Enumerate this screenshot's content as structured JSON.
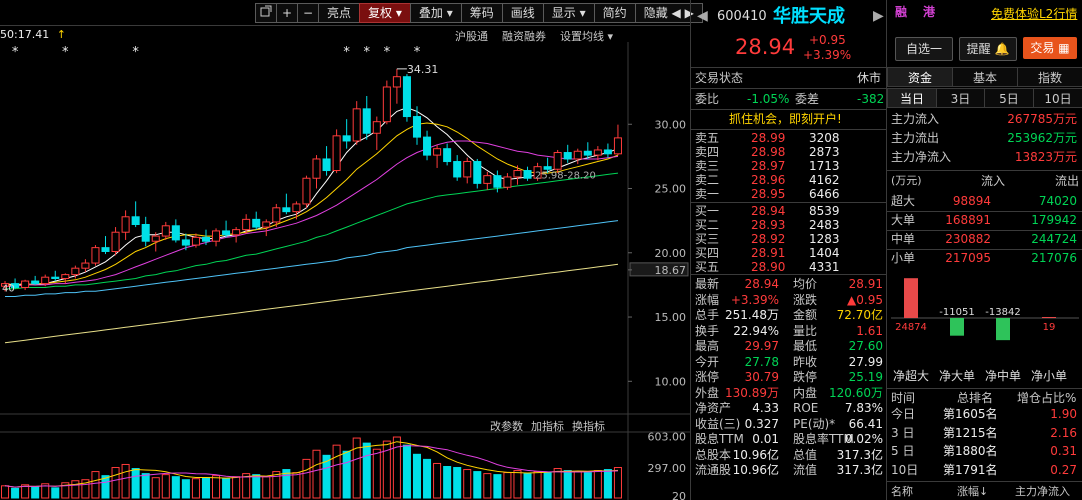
{
  "toolbar": {
    "items": [
      "亮点",
      "复权",
      "叠加",
      "筹码",
      "画线",
      "显示",
      "简约",
      "隐藏"
    ],
    "dropdown_marks": [
      "",
      "▾",
      "▾",
      "",
      "",
      "▾",
      "",
      ""
    ],
    "chevrons": "◀ ▶"
  },
  "chart_sub": {
    "cursor_readout": "50:17.41",
    "links": [
      "沪股通",
      "融资融券",
      "设置均线"
    ],
    "high_label": "34.31",
    "mark_label": "40",
    "price_axis": [
      "30.00",
      "25.00",
      "20.00",
      "18.67",
      "15.00",
      "10.00"
    ],
    "ma_label": "25.98-28.20",
    "vol_links": [
      "改参数",
      "加指标",
      "换指标"
    ],
    "vol_axis": [
      "603.00",
      "297.00",
      "20"
    ]
  },
  "chart_data": {
    "type": "candlestick",
    "price_ylim": [
      8,
      35
    ],
    "candles": [
      [
        17.4,
        17.8,
        17.0,
        17.6
      ],
      [
        17.6,
        18.0,
        17.2,
        17.3
      ],
      [
        17.3,
        17.9,
        17.1,
        17.8
      ],
      [
        17.8,
        18.2,
        17.5,
        17.6
      ],
      [
        17.6,
        18.3,
        17.4,
        18.1
      ],
      [
        18.1,
        18.6,
        17.8,
        18.0
      ],
      [
        18.0,
        18.4,
        17.6,
        18.3
      ],
      [
        18.3,
        19.0,
        18.0,
        18.8
      ],
      [
        18.8,
        19.5,
        18.5,
        19.2
      ],
      [
        19.2,
        20.6,
        19.0,
        20.4
      ],
      [
        20.4,
        21.3,
        19.9,
        20.1
      ],
      [
        20.1,
        22.0,
        19.8,
        21.6
      ],
      [
        21.6,
        23.3,
        21.0,
        22.8
      ],
      [
        22.8,
        24.0,
        22.0,
        22.2
      ],
      [
        22.2,
        22.8,
        20.5,
        20.9
      ],
      [
        20.9,
        21.6,
        20.1,
        21.3
      ],
      [
        21.3,
        22.4,
        21.0,
        22.1
      ],
      [
        22.1,
        22.6,
        20.8,
        21.0
      ],
      [
        21.0,
        21.5,
        20.2,
        20.6
      ],
      [
        20.6,
        21.5,
        20.4,
        21.2
      ],
      [
        21.2,
        21.8,
        20.6,
        20.9
      ],
      [
        20.9,
        21.9,
        20.5,
        21.7
      ],
      [
        21.7,
        22.5,
        21.2,
        21.4
      ],
      [
        21.4,
        22.0,
        20.8,
        21.8
      ],
      [
        21.8,
        23.0,
        21.5,
        22.6
      ],
      [
        22.6,
        23.2,
        21.8,
        22.0
      ],
      [
        22.0,
        22.6,
        21.3,
        22.4
      ],
      [
        22.4,
        23.8,
        22.0,
        23.5
      ],
      [
        23.5,
        24.6,
        23.0,
        23.2
      ],
      [
        23.2,
        24.0,
        22.6,
        23.8
      ],
      [
        23.8,
        26.0,
        23.5,
        25.8
      ],
      [
        25.8,
        27.6,
        25.0,
        27.3
      ],
      [
        27.3,
        28.3,
        26.0,
        26.4
      ],
      [
        26.4,
        29.6,
        26.2,
        29.1
      ],
      [
        29.1,
        30.4,
        28.1,
        28.7
      ],
      [
        28.7,
        31.8,
        28.4,
        31.2
      ],
      [
        31.2,
        32.2,
        28.8,
        29.3
      ],
      [
        29.3,
        30.6,
        28.0,
        30.2
      ],
      [
        30.2,
        33.4,
        30.0,
        32.9
      ],
      [
        32.9,
        34.31,
        31.6,
        33.7
      ],
      [
        33.7,
        33.9,
        30.2,
        30.6
      ],
      [
        30.6,
        31.4,
        28.4,
        29.0
      ],
      [
        29.0,
        29.5,
        27.2,
        27.6
      ],
      [
        27.6,
        28.4,
        26.6,
        28.1
      ],
      [
        28.1,
        28.5,
        26.8,
        27.1
      ],
      [
        27.1,
        27.6,
        25.6,
        25.9
      ],
      [
        25.9,
        27.4,
        25.4,
        27.1
      ],
      [
        27.1,
        27.3,
        25.0,
        25.4
      ],
      [
        25.4,
        26.3,
        24.9,
        26.0
      ],
      [
        26.0,
        26.4,
        24.7,
        25.1
      ],
      [
        25.1,
        26.2,
        24.9,
        25.9
      ],
      [
        25.9,
        26.8,
        25.3,
        26.4
      ],
      [
        26.4,
        26.7,
        25.6,
        25.8
      ],
      [
        25.8,
        27.0,
        25.6,
        26.7
      ],
      [
        26.7,
        27.4,
        26.2,
        26.5
      ],
      [
        26.5,
        28.0,
        26.2,
        27.8
      ],
      [
        27.8,
        28.4,
        27.0,
        27.3
      ],
      [
        27.3,
        28.1,
        26.9,
        27.9
      ],
      [
        27.9,
        28.6,
        27.3,
        27.6
      ],
      [
        27.6,
        28.3,
        27.2,
        28.0
      ],
      [
        28.0,
        28.5,
        27.4,
        27.7
      ],
      [
        27.7,
        29.97,
        27.6,
        28.94
      ]
    ],
    "volume_ylim": [
      0,
      620
    ],
    "volumes": [
      120,
      95,
      130,
      110,
      140,
      100,
      150,
      170,
      180,
      260,
      220,
      300,
      330,
      290,
      240,
      200,
      230,
      210,
      180,
      190,
      200,
      220,
      190,
      210,
      240,
      230,
      210,
      260,
      280,
      250,
      380,
      470,
      420,
      520,
      460,
      590,
      540,
      480,
      560,
      600,
      520,
      430,
      380,
      340,
      310,
      300,
      280,
      260,
      240,
      230,
      250,
      270,
      240,
      260,
      250,
      290,
      270,
      260,
      250,
      270,
      280,
      300
    ],
    "ma_series": [
      {
        "color": "#ffffff",
        "values": [
          17.6,
          17.5,
          17.6,
          17.5,
          17.6,
          17.8,
          18.0,
          18.2,
          18.5,
          18.9,
          19.3,
          19.9,
          20.6,
          21.2,
          21.4,
          21.4,
          21.6,
          21.6,
          21.4,
          21.2,
          21.1,
          21.1,
          21.3,
          21.4,
          21.7,
          21.8,
          22.1,
          22.5,
          22.8,
          23.0,
          23.5,
          24.6,
          25.6,
          26.7,
          27.8,
          28.6,
          29.0,
          29.5,
          30.3,
          31.0,
          31.3,
          31.0,
          30.5,
          29.8,
          29.2,
          28.4,
          27.6,
          26.9,
          26.4,
          25.9,
          25.7,
          25.8,
          25.9,
          26.1,
          26.3,
          26.6,
          26.9,
          27.2,
          27.4,
          27.6,
          27.8,
          28.1
        ]
      },
      {
        "color": "#ffd400",
        "values": [
          17.5,
          17.5,
          17.5,
          17.6,
          17.6,
          17.7,
          17.8,
          17.9,
          18.1,
          18.4,
          18.7,
          19.1,
          19.6,
          20.1,
          20.4,
          20.8,
          21.1,
          21.3,
          21.4,
          21.4,
          21.3,
          21.3,
          21.4,
          21.5,
          21.6,
          21.8,
          21.9,
          22.2,
          22.5,
          22.8,
          23.2,
          23.7,
          24.3,
          25.0,
          25.7,
          26.5,
          27.1,
          27.7,
          28.4,
          29.1,
          29.6,
          30.0,
          30.1,
          30.0,
          29.8,
          29.4,
          28.9,
          28.3,
          27.8,
          27.3,
          26.9,
          26.6,
          26.3,
          26.2,
          26.2,
          26.3,
          26.5,
          26.7,
          26.9,
          27.1,
          27.3,
          27.6
        ]
      },
      {
        "color": "#e040e0",
        "values": [
          17.4,
          17.4,
          17.5,
          17.5,
          17.5,
          17.6,
          17.6,
          17.7,
          17.8,
          17.9,
          18.1,
          18.3,
          18.6,
          18.9,
          19.2,
          19.5,
          19.8,
          20.1,
          20.4,
          20.6,
          20.8,
          21.0,
          21.2,
          21.3,
          21.5,
          21.6,
          21.7,
          21.9,
          22.1,
          22.3,
          22.6,
          22.9,
          23.3,
          23.7,
          24.2,
          24.7,
          25.2,
          25.7,
          26.3,
          26.9,
          27.4,
          27.8,
          28.1,
          28.4,
          28.6,
          28.7,
          28.7,
          28.6,
          28.5,
          28.3,
          28.1,
          27.9,
          27.8,
          27.6,
          27.5,
          27.4,
          27.3,
          27.3,
          27.3,
          27.3,
          27.4,
          27.5
        ]
      },
      {
        "color": "#00d455",
        "values": [
          17.2,
          17.2,
          17.3,
          17.3,
          17.3,
          17.4,
          17.4,
          17.5,
          17.5,
          17.6,
          17.7,
          17.8,
          17.9,
          18.0,
          18.2,
          18.3,
          18.5,
          18.6,
          18.8,
          19.0,
          19.1,
          19.3,
          19.4,
          19.6,
          19.8,
          19.9,
          20.1,
          20.3,
          20.5,
          20.7,
          20.9,
          21.2,
          21.4,
          21.7,
          22.0,
          22.3,
          22.6,
          22.9,
          23.2,
          23.5,
          23.8,
          24.0,
          24.2,
          24.4,
          24.5,
          24.6,
          24.7,
          24.8,
          24.9,
          25.0,
          25.1,
          25.2,
          25.3,
          25.4,
          25.5,
          25.6,
          25.7,
          25.8,
          25.9,
          26.0,
          26.1,
          26.2
        ]
      },
      {
        "color": "#4fc3f7",
        "values": [
          16.6,
          16.6,
          16.7,
          16.7,
          16.8,
          16.8,
          16.9,
          16.9,
          17.0,
          17.0,
          17.1,
          17.2,
          17.3,
          17.4,
          17.5,
          17.6,
          17.7,
          17.8,
          17.9,
          18.0,
          18.1,
          18.2,
          18.3,
          18.4,
          18.5,
          18.6,
          18.7,
          18.8,
          18.9,
          19.0,
          19.1,
          19.2,
          19.3,
          19.4,
          19.6,
          19.7,
          19.8,
          20.0,
          20.1,
          20.2,
          20.4,
          20.5,
          20.6,
          20.7,
          20.8,
          20.9,
          21.0,
          21.1,
          21.2,
          21.3,
          21.4,
          21.5,
          21.6,
          21.7,
          21.8,
          21.9,
          22.0,
          22.1,
          22.2,
          22.3,
          22.4,
          22.5
        ]
      },
      {
        "color": "#e8e08a",
        "values": [
          13.0,
          13.1,
          13.2,
          13.3,
          13.4,
          13.5,
          13.6,
          13.7,
          13.8,
          13.9,
          14.0,
          14.1,
          14.2,
          14.3,
          14.4,
          14.5,
          14.6,
          14.7,
          14.8,
          14.9,
          15.0,
          15.1,
          15.2,
          15.3,
          15.4,
          15.5,
          15.6,
          15.7,
          15.8,
          15.9,
          16.0,
          16.1,
          16.2,
          16.3,
          16.4,
          16.5,
          16.6,
          16.7,
          16.8,
          16.9,
          17.0,
          17.1,
          17.2,
          17.3,
          17.4,
          17.5,
          17.6,
          17.7,
          17.8,
          17.9,
          18.0,
          18.1,
          18.2,
          18.3,
          18.4,
          18.5,
          18.6,
          18.7,
          18.8,
          18.9,
          19.0,
          19.1
        ]
      }
    ],
    "star_marks": 7
  },
  "header": {
    "code": "600410",
    "name": "华胜天成",
    "tags": [
      "融",
      "港"
    ],
    "trial_link": "免费体验L2行情",
    "price": "28.94",
    "change": "+0.95",
    "change_pct": "+3.39%",
    "select_btn": "自选一",
    "remind_btn": "提醒",
    "trade_btn": "交易"
  },
  "status": {
    "label": "交易状态",
    "value": "休市"
  },
  "ratio": {
    "wb_label": "委比",
    "wb": "-1.05%",
    "wc_label": "委差",
    "wc": "-382"
  },
  "promo": "抓住机会，即刻开户!",
  "asks": [
    {
      "label": "卖五",
      "price": "28.99",
      "vol": "3208"
    },
    {
      "label": "卖四",
      "price": "28.98",
      "vol": "2873"
    },
    {
      "label": "卖三",
      "price": "28.97",
      "vol": "1713"
    },
    {
      "label": "卖二",
      "price": "28.96",
      "vol": "4162"
    },
    {
      "label": "卖一",
      "price": "28.95",
      "vol": "6466"
    }
  ],
  "bids": [
    {
      "label": "买一",
      "price": "28.94",
      "vol": "8539"
    },
    {
      "label": "买二",
      "price": "28.93",
      "vol": "2483"
    },
    {
      "label": "买三",
      "price": "28.92",
      "vol": "1283"
    },
    {
      "label": "买四",
      "price": "28.91",
      "vol": "1404"
    },
    {
      "label": "买五",
      "price": "28.90",
      "vol": "4331"
    }
  ],
  "stats": [
    {
      "l1": "最新",
      "v1": "28.94",
      "c1": "red",
      "l2": "均价",
      "v2": "28.91",
      "c2": "red"
    },
    {
      "l1": "涨幅",
      "v1": "+3.39%",
      "c1": "red",
      "l2": "涨跌",
      "v2": "▲0.95",
      "c2": "red"
    },
    {
      "l1": "总手",
      "v1": "251.48万",
      "c1": "white",
      "l2": "金额",
      "v2": "72.70亿",
      "c2": "yellow"
    },
    {
      "l1": "换手",
      "v1": "22.94%",
      "c1": "white",
      "l2": "量比",
      "v2": "1.61",
      "c2": "red"
    },
    {
      "l1": "最高",
      "v1": "29.97",
      "c1": "red",
      "l2": "最低",
      "v2": "27.60",
      "c2": "green"
    },
    {
      "l1": "今开",
      "v1": "27.78",
      "c1": "green",
      "l2": "昨收",
      "v2": "27.99",
      "c2": "white"
    },
    {
      "l1": "涨停",
      "v1": "30.79",
      "c1": "red",
      "l2": "跌停",
      "v2": "25.19",
      "c2": "green"
    },
    {
      "l1": "外盘",
      "v1": "130.89万",
      "c1": "red",
      "l2": "内盘",
      "v2": "120.60万",
      "c2": "green"
    },
    {
      "l1": "净资产",
      "v1": "4.33",
      "c1": "white",
      "l2": "ROE",
      "v2": "7.83%",
      "c2": "white"
    },
    {
      "l1": "收益(三)",
      "v1": "0.327",
      "c1": "white",
      "l2": "PE(动)*",
      "v2": "66.41",
      "c2": "white"
    },
    {
      "l1": "股息TTM",
      "v1": "0.01",
      "c1": "white",
      "l2": "股息率TTM",
      "v2": "0.02%",
      "c2": "white"
    },
    {
      "l1": "总股本",
      "v1": "10.96亿",
      "c1": "white",
      "l2": "总值",
      "v2": "317.3亿",
      "c2": "white"
    },
    {
      "l1": "流通股",
      "v1": "10.96亿",
      "c1": "white",
      "l2": "流值",
      "v2": "317.3亿",
      "c2": "white"
    }
  ],
  "side": {
    "tabs": [
      "资金",
      "基本",
      "指数"
    ],
    "period_tabs": [
      "当日",
      "3日",
      "5日",
      "10日"
    ],
    "flows": [
      {
        "label": "主力流入",
        "value": "267785万元",
        "color": "red"
      },
      {
        "label": "主力流出",
        "value": "253962万元",
        "color": "green"
      },
      {
        "label": "主力净流入",
        "value": "13823万元",
        "color": "red"
      }
    ],
    "unit": "(万元)",
    "in_label": "流入",
    "out_label": "流出",
    "breakdown": [
      {
        "label": "超大",
        "in": "98894",
        "out": "74020"
      },
      {
        "label": "大单",
        "in": "168891",
        "out": "179942"
      },
      {
        "label": "中单",
        "in": "230882",
        "out": "244724"
      },
      {
        "label": "小单",
        "in": "217095",
        "out": "217076"
      }
    ],
    "net_bars": [
      {
        "label": "净超大",
        "value": 24874,
        "text": "24874"
      },
      {
        "label": "净大单",
        "value": -11051,
        "text": "-11051"
      },
      {
        "label": "净中单",
        "value": -13842,
        "text": "-13842"
      },
      {
        "label": "净小单",
        "value": 19,
        "text": "19"
      }
    ],
    "rank_header": [
      "时间",
      "总排名",
      "增仓占比%"
    ],
    "ranks": [
      {
        "t": "今日",
        "r": "第1605名",
        "p": "1.90"
      },
      {
        "t": "3 日",
        "r": "第1215名",
        "p": "2.16"
      },
      {
        "t": "5 日",
        "r": "第1880名",
        "p": "0.31"
      },
      {
        "t": "10日",
        "r": "第1791名",
        "p": "0.27"
      }
    ],
    "footer": [
      "名称",
      "涨幅↓",
      "主力净流入"
    ]
  }
}
